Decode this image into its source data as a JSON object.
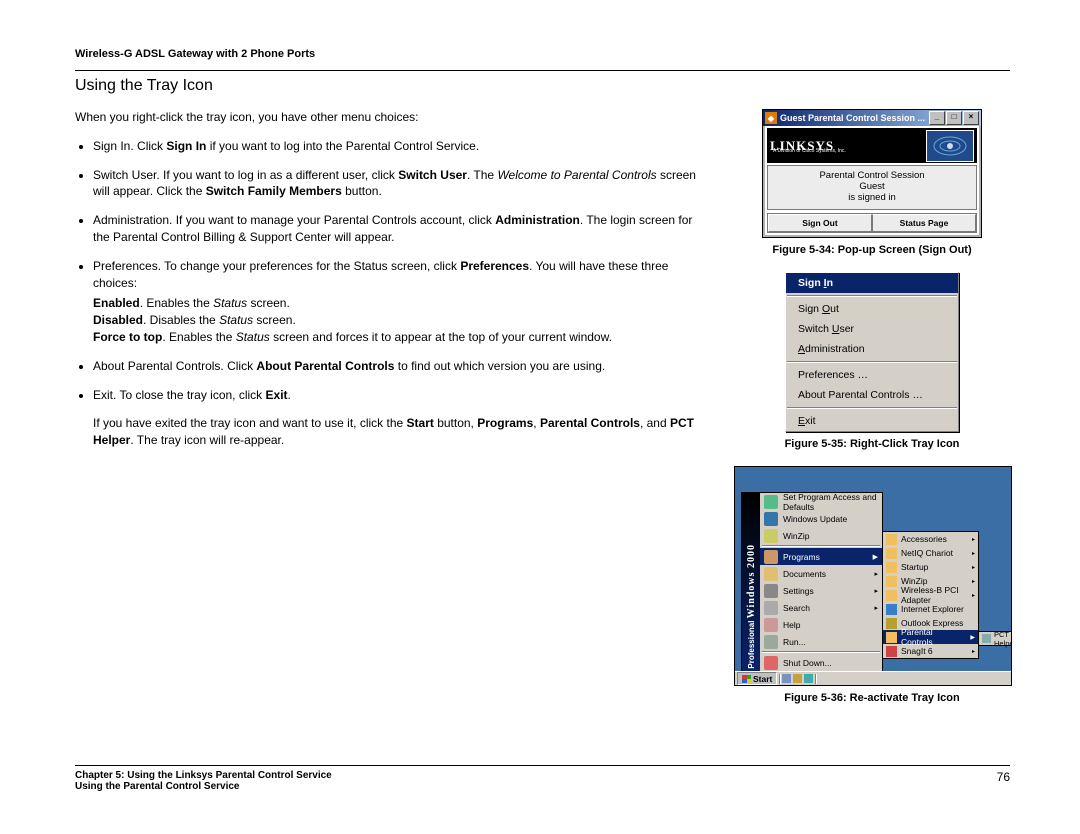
{
  "header": {
    "product": "Wireless-G ADSL Gateway with 2 Phone Ports"
  },
  "section": {
    "title": "Using the Tray Icon"
  },
  "intro": "When you right-click the tray icon, you have other menu choices:",
  "bullets": {
    "b1_a": "Sign In. Click ",
    "b1_b": "Sign In",
    "b1_c": " if you want to log into the Parental Control Service.",
    "b2_a": "Switch User. If you want to log in as a different user, click ",
    "b2_b": "Switch User",
    "b2_c": ". The ",
    "b2_d": "Welcome to Parental Controls",
    "b2_e": " screen will appear. Click the ",
    "b2_f": "Switch Family Members",
    "b2_g": " button.",
    "b3_a": "Administration. If you want to manage your Parental Controls account, click ",
    "b3_b": "Administration",
    "b3_c": ". The login screen for the Parental Control Billing & Support Center will appear.",
    "b4_a": "Preferences. To change your preferences for the Status screen, click ",
    "b4_b": "Preferences",
    "b4_c": ". You will have these three choices:",
    "b4_en_a": "Enabled",
    "b4_en_b": ". Enables the ",
    "b4_en_c": "Status",
    "b4_en_d": " screen.",
    "b4_di_a": "Disabled",
    "b4_di_b": ". Disables the ",
    "b4_di_c": "Status",
    "b4_di_d": " screen.",
    "b4_ft_a": "Force to top",
    "b4_ft_b": ". Enables the ",
    "b4_ft_c": "Status",
    "b4_ft_d": " screen and forces it to appear at the top of your current window.",
    "b5_a": "About Parental Controls. Click ",
    "b5_b": "About Parental Controls",
    "b5_c": " to find out which version you are using.",
    "b6_a": "Exit. To close the tray icon, click ",
    "b6_b": "Exit",
    "b6_c": ".",
    "tail_a": "If you have exited the tray icon and want to use it, click the ",
    "tail_b": "Start",
    "tail_c": " button, ",
    "tail_d": "Programs",
    "tail_e": ", ",
    "tail_f": "Parental Controls",
    "tail_g": ", and ",
    "tail_h": "PCT Helper",
    "tail_i": ". The tray icon will re-appear."
  },
  "fig34": {
    "caption": "Figure 5-34: Pop-up Screen (Sign Out)",
    "window_title": "Guest Parental Control Session ...",
    "brand": "LINKSYS",
    "brand_sub": "A Division of Cisco Systems, Inc.",
    "line1": "Parental Control Session",
    "line2": "Guest",
    "line3": "is signed in",
    "btn1": "Sign Out",
    "btn2": "Status Page",
    "min": "_",
    "max": "□",
    "close": "×"
  },
  "fig35": {
    "caption": "Figure 5-35: Right-Click Tray Icon",
    "items": {
      "signin": "Sign In",
      "signin_k": "I",
      "signout": "Sign ",
      "signout_u": "O",
      "signout_r": "ut",
      "switch": "Switch ",
      "switch_u": "U",
      "switch_r": "ser",
      "admin_u": "A",
      "admin_r": "dministration",
      "prefs": "Preferences …",
      "about": "About Parental Controls …",
      "exit": "E",
      "exit_r": "xit"
    }
  },
  "fig36": {
    "caption": "Figure 5-36: Re-activate Tray Icon",
    "band_pro": "Professional",
    "band_prod": "Windows 2000",
    "m1": [
      "Set Program Access and Defaults",
      "Windows Update",
      "WinZip",
      "Programs",
      "Documents",
      "Settings",
      "Search",
      "Help",
      "Run...",
      "Shut Down..."
    ],
    "m2": [
      "Accessories",
      "NetIQ Chariot",
      "Startup",
      "WinZip",
      "Wireless-B PCI Adapter",
      "Internet Explorer",
      "Outlook Express",
      "Parental Controls",
      "SnagIt  6"
    ],
    "m3": "PCT Helper",
    "start": "Start"
  },
  "footer": {
    "chapter": "Chapter 5: Using the Linksys Parental Control Service",
    "sub": "Using the Parental Control Service",
    "page": "76"
  }
}
